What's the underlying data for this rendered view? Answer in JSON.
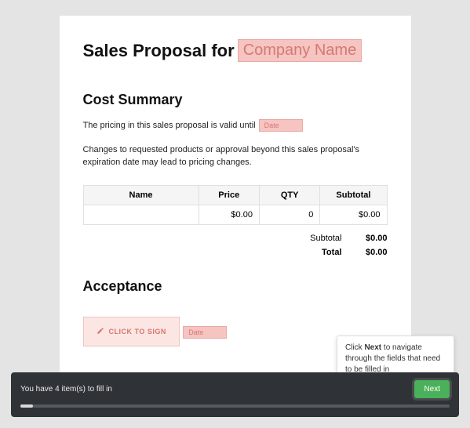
{
  "title_prefix": "Sales Proposal for",
  "company_placeholder": "Company Name",
  "cost_summary": {
    "heading": "Cost Summary",
    "pricing_prefix": "The pricing in this sales proposal is valid until",
    "date_placeholder": "Date",
    "changes_note": "Changes to requested products or approval beyond this sales proposal's expiration date may lead to pricing changes."
  },
  "table": {
    "headers": {
      "name": "Name",
      "price": "Price",
      "qty": "QTY",
      "subtotal": "Subtotal"
    },
    "rows": [
      {
        "name": "",
        "price": "$0.00",
        "qty": "0",
        "subtotal": "$0.00"
      }
    ],
    "totals": {
      "subtotal_label": "Subtotal",
      "subtotal_value": "$0.00",
      "total_label": "Total",
      "total_value": "$0.00"
    }
  },
  "acceptance": {
    "heading": "Acceptance",
    "sign_label": "CLICK TO SIGN",
    "date_placeholder": "Date"
  },
  "tooltip": {
    "pre": "Click ",
    "bold": "Next",
    "post": " to navigate through the fields that need to be filled in"
  },
  "bottom_bar": {
    "message": "You have 4 item(s) to fill in",
    "next_label": "Next"
  }
}
